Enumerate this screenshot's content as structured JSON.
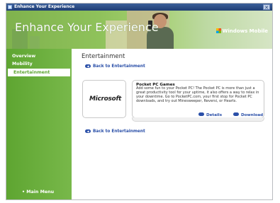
{
  "window": {
    "title": "Enhance Your Experience"
  },
  "banner": {
    "heading": "Enhance Your Experience",
    "brand": "Windows Mobile"
  },
  "sidebar": {
    "items": [
      {
        "label": "Overview",
        "active": false
      },
      {
        "label": "Mobility",
        "active": false
      },
      {
        "label": "Entertainment",
        "active": true
      }
    ],
    "main_menu": "• Main Menu"
  },
  "content": {
    "heading": "Entertainment",
    "back_top": "Back to Entertainment",
    "back_bottom": "Back to Entertainment",
    "product": {
      "logo_text": "Microsoft",
      "title": "Pocket PC Games",
      "description": "Add some fun to your Pocket PC! The Pocket PC is more than just a great productivity tool for your uptime, it also offers a way to relax in your downtime. Go to PocketPC.com, your first stop for Pocket PC downloads, and try out Minesweeper, Reversi, or Hearts.",
      "details_label": "Details",
      "download_label": "Download"
    }
  },
  "colors": {
    "sidebar": "#5ea531",
    "link": "#2a4fa8",
    "titlebar": "#1f3d73"
  }
}
